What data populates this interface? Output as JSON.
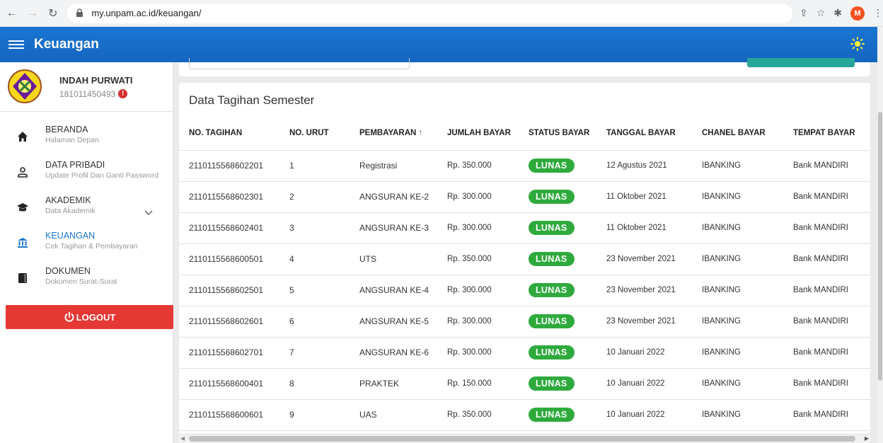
{
  "browser": {
    "url": "my.unpam.ac.id/keuangan/",
    "profile_initial": "M"
  },
  "app": {
    "title": "Keuangan"
  },
  "user": {
    "name": "INDAH PURWATI",
    "id": "181011450493",
    "alert": "!"
  },
  "sidebar": {
    "items": [
      {
        "title": "BERANDA",
        "sub": "Halaman Depan",
        "icon": "home-icon"
      },
      {
        "title": "DATA PRIBADI",
        "sub": "Update Profil Dan Ganti Password",
        "icon": "person-icon"
      },
      {
        "title": "AKADEMIK",
        "sub": "Data Akademik",
        "icon": "graduation-cap-icon"
      },
      {
        "title": "KEUANGAN",
        "sub": "Cek Tagihan & Pembayaran",
        "icon": "bank-icon"
      },
      {
        "title": "DOKUMEN",
        "sub": "Dokumen Surat-Surat",
        "icon": "document-icon"
      }
    ],
    "logout_label": "LOGOUT"
  },
  "main": {
    "card_title": "Data Tagihan Semester",
    "columns": [
      "NO. TAGIHAN",
      "NO. URUT",
      "PEMBAYARAN",
      "JUMLAH BAYAR",
      "STATUS BAYAR",
      "TANGGAL BAYAR",
      "CHANEL BAYAR",
      "TEMPAT BAYAR"
    ],
    "sort_arrow": "↑",
    "rows": [
      {
        "no_tagihan": "2110115568602201",
        "no_urut": "1",
        "pembayaran": "Registrasi",
        "jumlah": "Rp. 350.000",
        "status": "LUNAS",
        "tanggal": "12 Agustus 2021",
        "chanel": "IBANKING",
        "tempat": "Bank MANDIRI"
      },
      {
        "no_tagihan": "2110115568602301",
        "no_urut": "2",
        "pembayaran": "ANGSURAN KE-2",
        "jumlah": "Rp. 300.000",
        "status": "LUNAS",
        "tanggal": "11 Oktober 2021",
        "chanel": "IBANKING",
        "tempat": "Bank MANDIRI"
      },
      {
        "no_tagihan": "2110115568602401",
        "no_urut": "3",
        "pembayaran": "ANGSURAN KE-3",
        "jumlah": "Rp. 300.000",
        "status": "LUNAS",
        "tanggal": "11 Oktober 2021",
        "chanel": "IBANKING",
        "tempat": "Bank MANDIRI"
      },
      {
        "no_tagihan": "2110115568600501",
        "no_urut": "4",
        "pembayaran": "UTS",
        "jumlah": "Rp. 350.000",
        "status": "LUNAS",
        "tanggal": "23 November 2021",
        "chanel": "IBANKING",
        "tempat": "Bank MANDIRI"
      },
      {
        "no_tagihan": "2110115568602501",
        "no_urut": "5",
        "pembayaran": "ANGSURAN KE-4",
        "jumlah": "Rp. 300.000",
        "status": "LUNAS",
        "tanggal": "23 November 2021",
        "chanel": "IBANKING",
        "tempat": "Bank MANDIRI"
      },
      {
        "no_tagihan": "2110115568602601",
        "no_urut": "6",
        "pembayaran": "ANGSURAN KE-5",
        "jumlah": "Rp. 300.000",
        "status": "LUNAS",
        "tanggal": "23 November 2021",
        "chanel": "IBANKING",
        "tempat": "Bank MANDIRI"
      },
      {
        "no_tagihan": "2110115568602701",
        "no_urut": "7",
        "pembayaran": "ANGSURAN KE-6",
        "jumlah": "Rp. 300.000",
        "status": "LUNAS",
        "tanggal": "10 Januari 2022",
        "chanel": "IBANKING",
        "tempat": "Bank MANDIRI"
      },
      {
        "no_tagihan": "2110115568600401",
        "no_urut": "8",
        "pembayaran": "PRAKTEK",
        "jumlah": "Rp. 150.000",
        "status": "LUNAS",
        "tanggal": "10 Januari 2022",
        "chanel": "IBANKING",
        "tempat": "Bank MANDIRI"
      },
      {
        "no_tagihan": "2110115568600601",
        "no_urut": "9",
        "pembayaran": "UAS",
        "jumlah": "Rp. 350.000",
        "status": "LUNAS",
        "tanggal": "10 Januari 2022",
        "chanel": "IBANKING",
        "tempat": "Bank MANDIRI"
      }
    ]
  },
  "colors": {
    "appbar": "#1976d2",
    "status_lunas": "#2eaa3c",
    "logout": "#e53935",
    "active_menu": "#1976d2"
  }
}
